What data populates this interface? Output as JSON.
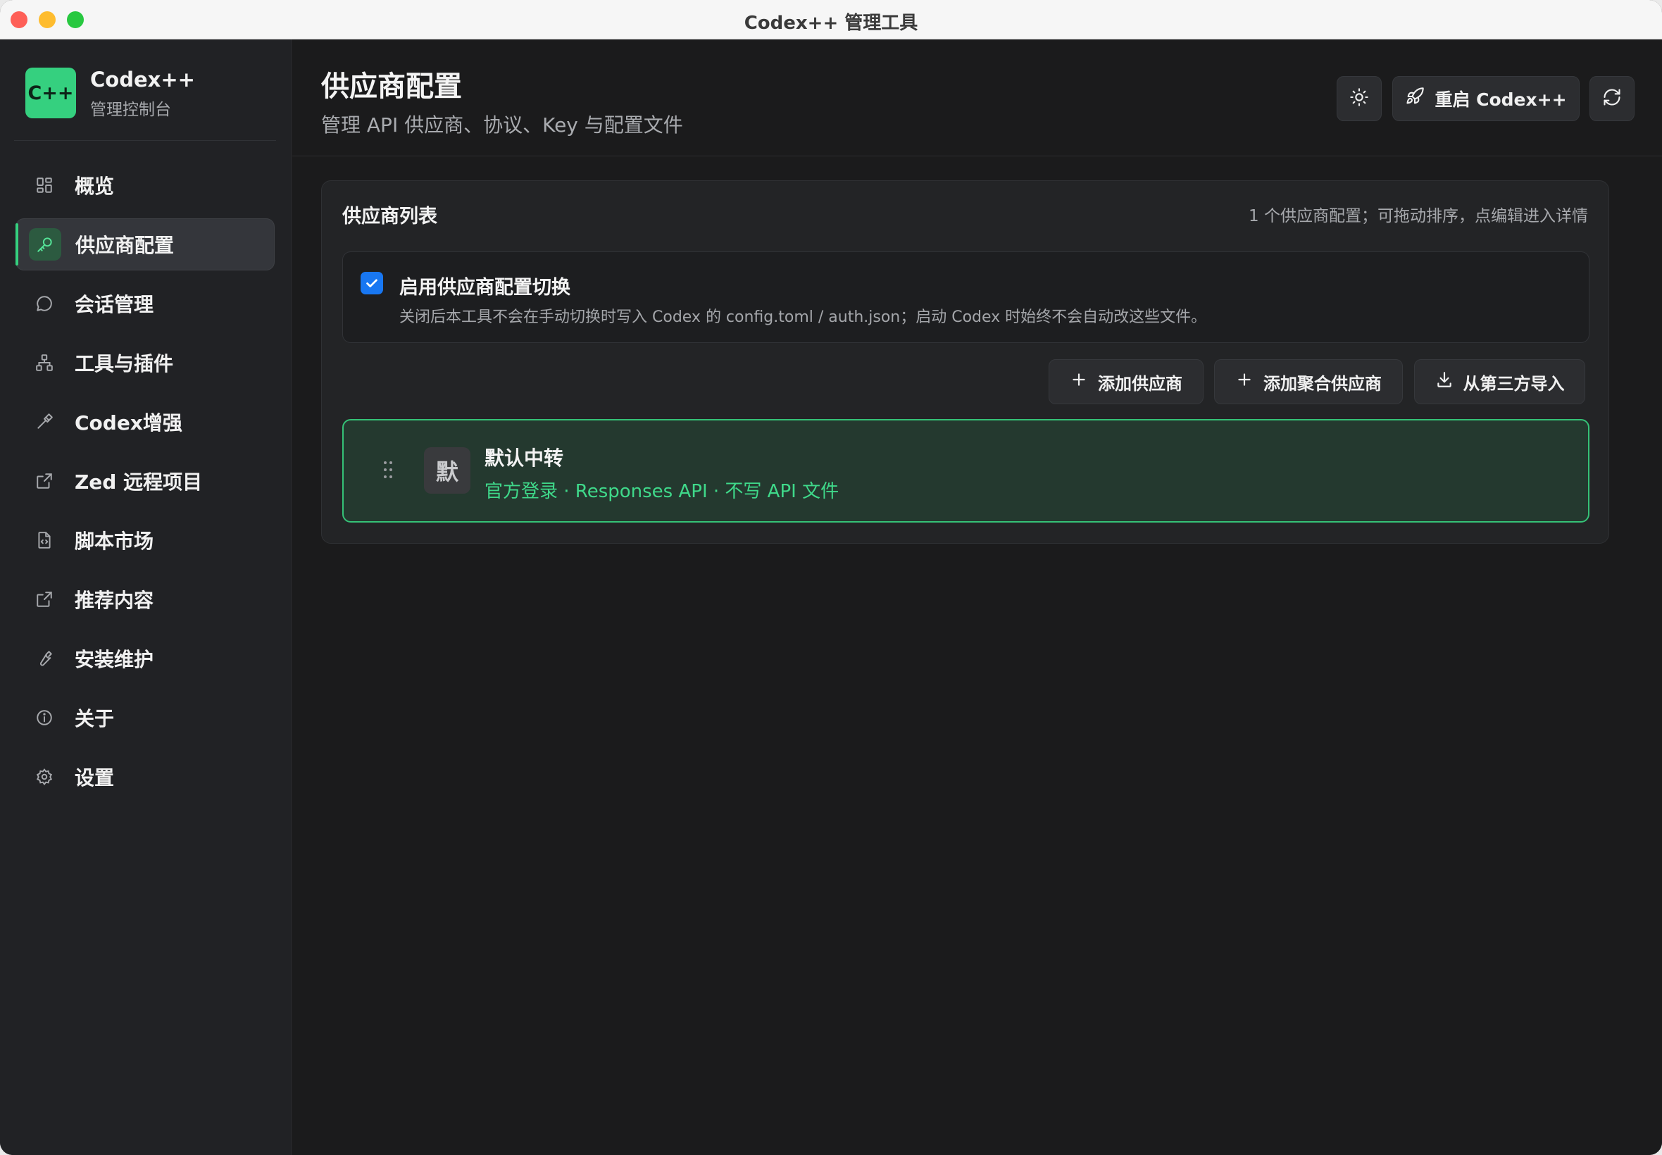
{
  "window": {
    "title": "Codex++ 管理工具"
  },
  "brand": {
    "logo": "C++",
    "name": "Codex++",
    "subtitle": "管理控制台",
    "accent": "#35d07f"
  },
  "sidebar": {
    "items": [
      {
        "label": "概览",
        "icon": "grid-icon",
        "active": false
      },
      {
        "label": "供应商配置",
        "icon": "key-icon",
        "active": true
      },
      {
        "label": "会话管理",
        "icon": "chat-bubble-icon",
        "active": false
      },
      {
        "label": "工具与插件",
        "icon": "network-icon",
        "active": false
      },
      {
        "label": "Codex增强",
        "icon": "hammer-icon",
        "active": false
      },
      {
        "label": "Zed 远程项目",
        "icon": "external-link-icon",
        "active": false
      },
      {
        "label": "脚本市场",
        "icon": "file-code-icon",
        "active": false
      },
      {
        "label": "推荐内容",
        "icon": "external-link-icon",
        "active": false
      },
      {
        "label": "安装维护",
        "icon": "wrench-icon",
        "active": false
      },
      {
        "label": "关于",
        "icon": "info-icon",
        "active": false
      },
      {
        "label": "设置",
        "icon": "gear-icon",
        "active": false
      }
    ]
  },
  "header": {
    "title": "供应商配置",
    "subtitle": "管理 API 供应商、协议、Key 与配置文件",
    "restart_label": "重启 Codex++"
  },
  "card": {
    "title": "供应商列表",
    "hint": "1 个供应商配置；可拖动排序，点编辑进入详情",
    "toggle": {
      "checked": true,
      "title": "启用供应商配置切换",
      "description": "关闭后本工具不会在手动切换时写入 Codex 的 config.toml / auth.json；启动 Codex 时始终不会自动改这些文件。"
    },
    "actions": {
      "add_label": "添加供应商",
      "add_aggregate_label": "添加聚合供应商",
      "import_label": "从第三方导入"
    },
    "providers": [
      {
        "avatar": "默",
        "name": "默认中转",
        "meta": "官方登录 · Responses API · 不写 API 文件"
      }
    ]
  }
}
